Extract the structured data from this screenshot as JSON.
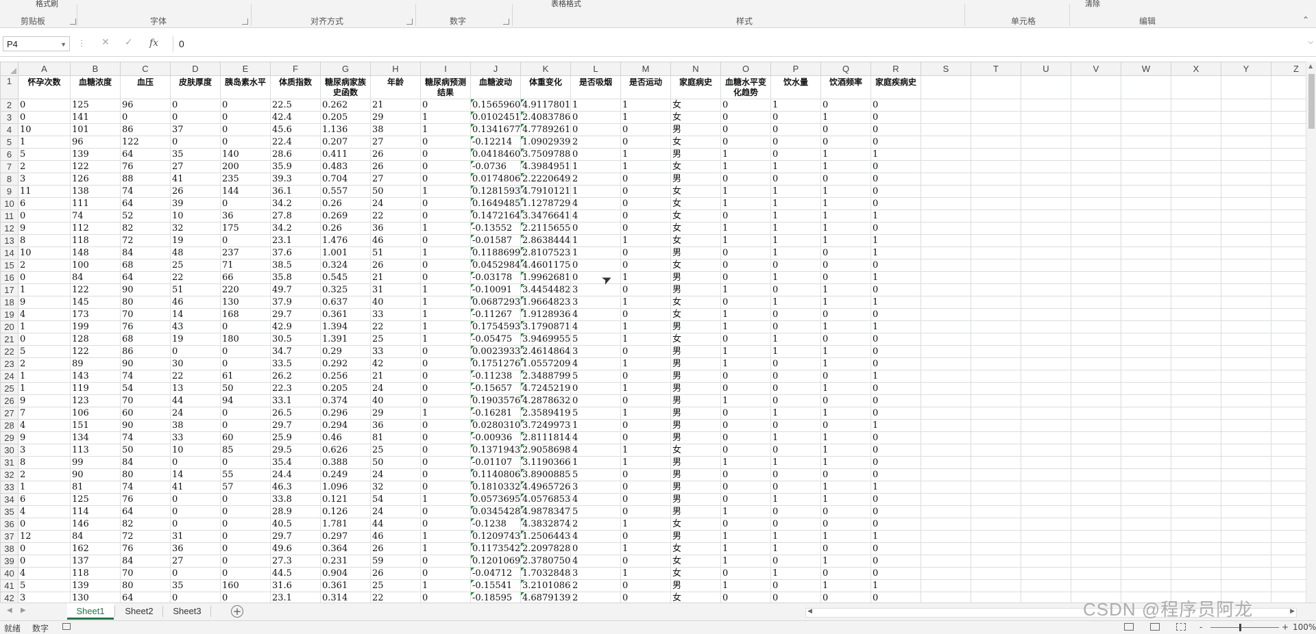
{
  "ribbon": {
    "top_fragments": [
      "格式刷",
      "表格格式",
      "清除"
    ],
    "groups": [
      {
        "label": "剪贴板"
      },
      {
        "label": "字体"
      },
      {
        "label": "对齐方式"
      },
      {
        "label": "数字"
      },
      {
        "label": "样式"
      },
      {
        "label": "单元格"
      },
      {
        "label": "编辑"
      }
    ]
  },
  "formula_bar": {
    "name_box": "P4",
    "fx_label": "fx",
    "value": "0"
  },
  "grid": {
    "columns": [
      "A",
      "B",
      "C",
      "D",
      "E",
      "F",
      "G",
      "H",
      "I",
      "J",
      "K",
      "L",
      "M",
      "N",
      "O",
      "P",
      "Q",
      "R",
      "S",
      "T",
      "U",
      "V",
      "W",
      "X",
      "Y",
      "Z"
    ],
    "header_row": [
      "怀孕次数",
      "血糖浓度",
      "血压",
      "皮肤厚度",
      "胰岛素水平",
      "体质指数",
      "糖尿病家族史函数",
      "年龄",
      "糖尿病预测结果",
      "血糖波动",
      "体重变化",
      "是否吸烟",
      "是否运动",
      "家庭病史",
      "血糖水平变化趋势",
      "饮水量",
      "饮酒频率",
      "家庭疾病史"
    ],
    "rows": [
      [
        "0",
        "125",
        "96",
        "0",
        "0",
        "22.5",
        "0.262",
        "21",
        "0",
        "0.1565960",
        "4.9117801",
        "1",
        "1",
        "女",
        "0",
        "1",
        "0",
        "0"
      ],
      [
        "0",
        "141",
        "0",
        "0",
        "0",
        "42.4",
        "0.205",
        "29",
        "1",
        "0.0102451",
        "2.4083786",
        "0",
        "1",
        "女",
        "0",
        "0",
        "1",
        "0"
      ],
      [
        "10",
        "101",
        "86",
        "37",
        "0",
        "45.6",
        "1.136",
        "38",
        "1",
        "0.1341677",
        "4.7789261",
        "0",
        "0",
        "男",
        "0",
        "0",
        "0",
        "0"
      ],
      [
        "1",
        "96",
        "122",
        "0",
        "0",
        "22.4",
        "0.207",
        "27",
        "0",
        "-0.12214",
        "1.0902939",
        "2",
        "0",
        "女",
        "0",
        "0",
        "0",
        "0"
      ],
      [
        "5",
        "139",
        "64",
        "35",
        "140",
        "28.6",
        "0.411",
        "26",
        "0",
        "0.0418460",
        "3.7509788",
        "0",
        "1",
        "男",
        "1",
        "0",
        "1",
        "1"
      ],
      [
        "2",
        "122",
        "76",
        "27",
        "200",
        "35.9",
        "0.483",
        "26",
        "0",
        "-0.0736",
        "4.3984951",
        "1",
        "1",
        "女",
        "1",
        "1",
        "1",
        "0"
      ],
      [
        "3",
        "126",
        "88",
        "41",
        "235",
        "39.3",
        "0.704",
        "27",
        "0",
        "0.0174806",
        "2.2220649",
        "2",
        "0",
        "男",
        "0",
        "0",
        "0",
        "0"
      ],
      [
        "11",
        "138",
        "74",
        "26",
        "144",
        "36.1",
        "0.557",
        "50",
        "1",
        "0.1281593",
        "4.7910121",
        "1",
        "0",
        "女",
        "1",
        "1",
        "1",
        "0"
      ],
      [
        "6",
        "111",
        "64",
        "39",
        "0",
        "34.2",
        "0.26",
        "24",
        "0",
        "0.1649485",
        "1.1278729",
        "4",
        "0",
        "女",
        "1",
        "1",
        "1",
        "0"
      ],
      [
        "0",
        "74",
        "52",
        "10",
        "36",
        "27.8",
        "0.269",
        "22",
        "0",
        "0.1472164",
        "3.3476641",
        "4",
        "0",
        "女",
        "0",
        "1",
        "1",
        "1"
      ],
      [
        "9",
        "112",
        "82",
        "32",
        "175",
        "34.2",
        "0.26",
        "36",
        "1",
        "-0.13552",
        "2.2115655",
        "0",
        "0",
        "女",
        "1",
        "1",
        "1",
        "0"
      ],
      [
        "8",
        "118",
        "72",
        "19",
        "0",
        "23.1",
        "1.476",
        "46",
        "0",
        "-0.01587",
        "2.8638444",
        "1",
        "1",
        "女",
        "1",
        "1",
        "1",
        "1"
      ],
      [
        "10",
        "148",
        "84",
        "48",
        "237",
        "37.6",
        "1.001",
        "51",
        "1",
        "0.1188699",
        "2.8107523",
        "1",
        "0",
        "男",
        "0",
        "1",
        "0",
        "1"
      ],
      [
        "2",
        "100",
        "68",
        "25",
        "71",
        "38.5",
        "0.324",
        "26",
        "0",
        "0.0452984",
        "4.4601175",
        "0",
        "0",
        "女",
        "0",
        "0",
        "0",
        "0"
      ],
      [
        "0",
        "84",
        "64",
        "22",
        "66",
        "35.8",
        "0.545",
        "21",
        "0",
        "-0.03178",
        "1.9962681",
        "0",
        "1",
        "男",
        "0",
        "1",
        "0",
        "1"
      ],
      [
        "1",
        "122",
        "90",
        "51",
        "220",
        "49.7",
        "0.325",
        "31",
        "1",
        "-0.10091",
        "3.4454482",
        "3",
        "0",
        "男",
        "1",
        "0",
        "1",
        "0"
      ],
      [
        "9",
        "145",
        "80",
        "46",
        "130",
        "37.9",
        "0.637",
        "40",
        "1",
        "0.0687293",
        "1.9664823",
        "3",
        "1",
        "女",
        "0",
        "1",
        "1",
        "1"
      ],
      [
        "4",
        "173",
        "70",
        "14",
        "168",
        "29.7",
        "0.361",
        "33",
        "1",
        "-0.11267",
        "1.9128936",
        "4",
        "0",
        "女",
        "1",
        "0",
        "0",
        "0"
      ],
      [
        "1",
        "199",
        "76",
        "43",
        "0",
        "42.9",
        "1.394",
        "22",
        "1",
        "0.1754593",
        "3.1790871",
        "4",
        "1",
        "男",
        "1",
        "0",
        "1",
        "1"
      ],
      [
        "0",
        "128",
        "68",
        "19",
        "180",
        "30.5",
        "1.391",
        "25",
        "1",
        "-0.05475",
        "3.9469955",
        "5",
        "1",
        "女",
        "0",
        "1",
        "0",
        "0"
      ],
      [
        "5",
        "122",
        "86",
        "0",
        "0",
        "34.7",
        "0.29",
        "33",
        "0",
        "0.0023933",
        "2.4614864",
        "3",
        "0",
        "男",
        "1",
        "1",
        "1",
        "0"
      ],
      [
        "2",
        "89",
        "90",
        "30",
        "0",
        "33.5",
        "0.292",
        "42",
        "0",
        "0.1751276",
        "1.0557209",
        "4",
        "1",
        "男",
        "1",
        "0",
        "1",
        "0"
      ],
      [
        "1",
        "143",
        "74",
        "22",
        "61",
        "26.2",
        "0.256",
        "21",
        "0",
        "-0.11238",
        "2.3488799",
        "5",
        "0",
        "男",
        "0",
        "0",
        "0",
        "1"
      ],
      [
        "1",
        "119",
        "54",
        "13",
        "50",
        "22.3",
        "0.205",
        "24",
        "0",
        "-0.15657",
        "4.7245219",
        "0",
        "1",
        "男",
        "0",
        "0",
        "1",
        "0"
      ],
      [
        "9",
        "123",
        "70",
        "44",
        "94",
        "33.1",
        "0.374",
        "40",
        "0",
        "0.1903576",
        "4.2878632",
        "0",
        "0",
        "男",
        "1",
        "0",
        "0",
        "0"
      ],
      [
        "7",
        "106",
        "60",
        "24",
        "0",
        "26.5",
        "0.296",
        "29",
        "1",
        "-0.16281",
        "2.3589419",
        "5",
        "1",
        "男",
        "0",
        "1",
        "1",
        "0"
      ],
      [
        "4",
        "151",
        "90",
        "38",
        "0",
        "29.7",
        "0.294",
        "36",
        "0",
        "0.0280310",
        "3.7249973",
        "1",
        "0",
        "男",
        "0",
        "0",
        "0",
        "1"
      ],
      [
        "9",
        "134",
        "74",
        "33",
        "60",
        "25.9",
        "0.46",
        "81",
        "0",
        "-0.00936",
        "2.8111814",
        "4",
        "0",
        "男",
        "0",
        "1",
        "1",
        "0"
      ],
      [
        "3",
        "113",
        "50",
        "10",
        "85",
        "29.5",
        "0.626",
        "25",
        "0",
        "0.1371943",
        "2.9058698",
        "4",
        "1",
        "女",
        "0",
        "0",
        "1",
        "0"
      ],
      [
        "8",
        "99",
        "84",
        "0",
        "0",
        "35.4",
        "0.388",
        "50",
        "0",
        "-0.01107",
        "3.1190366",
        "1",
        "1",
        "男",
        "1",
        "1",
        "1",
        "0"
      ],
      [
        "2",
        "90",
        "80",
        "14",
        "55",
        "24.4",
        "0.249",
        "24",
        "0",
        "0.1140806",
        "3.8900885",
        "5",
        "0",
        "男",
        "0",
        "0",
        "0",
        "0"
      ],
      [
        "1",
        "81",
        "74",
        "41",
        "57",
        "46.3",
        "1.096",
        "32",
        "0",
        "0.1810332",
        "4.4965726",
        "3",
        "0",
        "男",
        "0",
        "0",
        "1",
        "1"
      ],
      [
        "6",
        "125",
        "76",
        "0",
        "0",
        "33.8",
        "0.121",
        "54",
        "1",
        "0.0573695",
        "4.0576853",
        "4",
        "0",
        "男",
        "0",
        "1",
        "1",
        "0"
      ],
      [
        "4",
        "114",
        "64",
        "0",
        "0",
        "28.9",
        "0.126",
        "24",
        "0",
        "0.0345428",
        "4.9878347",
        "5",
        "0",
        "男",
        "1",
        "0",
        "0",
        "0"
      ],
      [
        "0",
        "146",
        "82",
        "0",
        "0",
        "40.5",
        "1.781",
        "44",
        "0",
        "-0.1238",
        "4.3832874",
        "2",
        "1",
        "女",
        "0",
        "0",
        "0",
        "0"
      ],
      [
        "12",
        "84",
        "72",
        "31",
        "0",
        "29.7",
        "0.297",
        "46",
        "1",
        "0.1209743",
        "1.2506443",
        "4",
        "0",
        "男",
        "1",
        "1",
        "1",
        "1"
      ],
      [
        "0",
        "162",
        "76",
        "36",
        "0",
        "49.6",
        "0.364",
        "26",
        "1",
        "0.1173542",
        "2.2097828",
        "0",
        "1",
        "女",
        "1",
        "1",
        "0",
        "0"
      ],
      [
        "0",
        "137",
        "84",
        "27",
        "0",
        "27.3",
        "0.231",
        "59",
        "0",
        "0.1201069",
        "2.3780750",
        "4",
        "0",
        "女",
        "1",
        "0",
        "1",
        "0"
      ],
      [
        "4",
        "118",
        "70",
        "0",
        "0",
        "44.5",
        "0.904",
        "26",
        "0",
        "-0.04712",
        "1.7032848",
        "3",
        "1",
        "女",
        "0",
        "1",
        "0",
        "0"
      ],
      [
        "5",
        "139",
        "80",
        "35",
        "160",
        "31.6",
        "0.361",
        "25",
        "1",
        "-0.15541",
        "3.2101086",
        "2",
        "0",
        "男",
        "1",
        "0",
        "1",
        "1"
      ],
      [
        "3",
        "130",
        "64",
        "0",
        "0",
        "23.1",
        "0.314",
        "22",
        "0",
        "-0.18595",
        "4.6879139",
        "2",
        "0",
        "女",
        "0",
        "0",
        "0",
        "0"
      ]
    ]
  },
  "sheets": {
    "tabs": [
      "Sheet1",
      "Sheet2",
      "Sheet3"
    ],
    "active": "Sheet1",
    "add_label": "+"
  },
  "status_bar": {
    "ready": "就绪",
    "mode": "数字",
    "zoom_minus": "-",
    "zoom_plus": "+",
    "zoom": "100%"
  },
  "watermark": "CSDN @程序员阿龙",
  "colors": {
    "accent": "#217346",
    "error_indicator": "#2e8b3e"
  }
}
